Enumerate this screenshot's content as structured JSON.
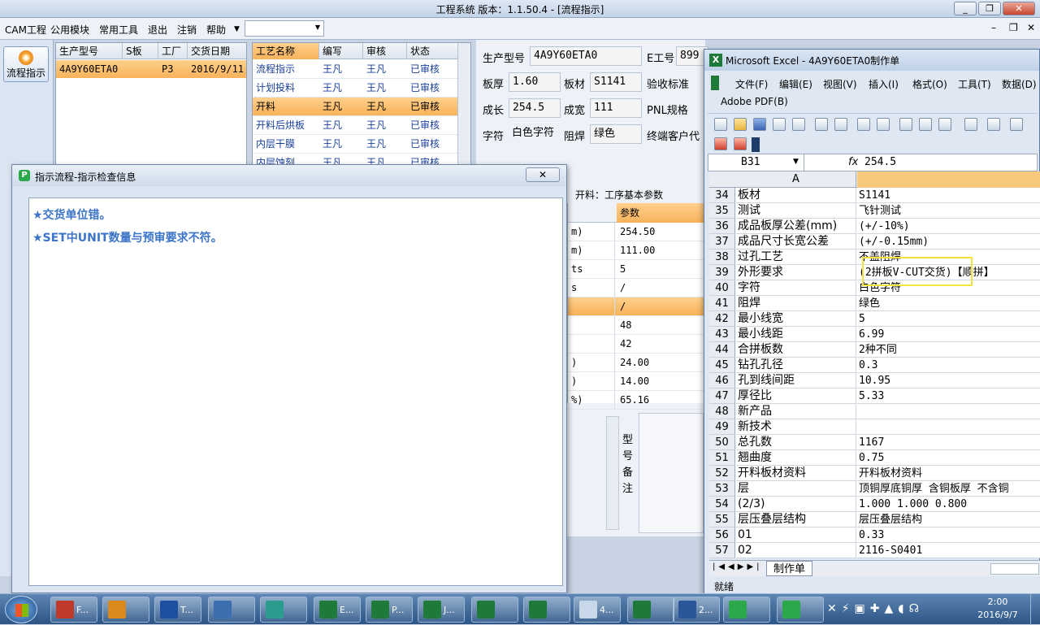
{
  "app": {
    "title": "工程系统  版本：1.1.50.4 - [流程指示]",
    "menu": [
      "CAM工程",
      "公用模块",
      "常用工具",
      "退出",
      "注销",
      "帮助"
    ]
  },
  "left_panel": {
    "flow_button": "流程指示"
  },
  "order_table": {
    "headers": [
      "生产型号",
      "S板",
      "工厂",
      "交货日期"
    ],
    "rows": [
      [
        "4A9Y60ETA0",
        "",
        "P3",
        "2016/9/11"
      ]
    ]
  },
  "process_table": {
    "headers": [
      "工艺名称",
      "编写",
      "审核",
      "状态"
    ],
    "rows": [
      [
        "流程指示",
        "王凡",
        "王凡",
        "已审核"
      ],
      [
        "计划投料",
        "王凡",
        "王凡",
        "已审核"
      ],
      [
        "开料",
        "王凡",
        "王凡",
        "已审核"
      ],
      [
        "开料后烘板",
        "王凡",
        "王凡",
        "已审核"
      ],
      [
        "内层干膜",
        "王凡",
        "王凡",
        "已审核"
      ],
      [
        "内层蚀刻",
        "王凡",
        "王凡",
        "已审核"
      ]
    ],
    "selected_index": 2
  },
  "form": {
    "product_label": "生产型号",
    "product_value": "4A9Y60ETA0",
    "e_label": "E工号",
    "e_value": "899",
    "thickness_label": "板厚",
    "thickness_value": "1.60",
    "material_label": "板材",
    "material_value": "S1141",
    "standard_label": "验收标准",
    "length_label": "成长",
    "length_value": "254.5",
    "width_label": "成宽",
    "width_value": "111",
    "pnl_label": "PNL规格",
    "char_label": "字符",
    "char_value": "白色字符",
    "mask_label": "阻焊",
    "mask_value": "绿色",
    "customer_label": "终端客户代"
  },
  "param_panel": {
    "title": "开料：工序基本参数",
    "param_header": "参数",
    "rows": [
      {
        "name": "m)",
        "value": "254.50"
      },
      {
        "name": "m)",
        "value": "111.00"
      },
      {
        "name": "ts",
        "value": "5"
      },
      {
        "name": "s",
        "value": "/"
      },
      {
        "name": "",
        "value": "/"
      },
      {
        "name": "",
        "value": "48"
      },
      {
        "name": "",
        "value": "42"
      },
      {
        "name": ")",
        "value": "24.00"
      },
      {
        "name": ")",
        "value": "14.00"
      },
      {
        "name": "%)",
        "value": "65.16"
      }
    ],
    "memo_label": "型号备注"
  },
  "dialog": {
    "title": "指示流程-指示检查信息",
    "messages": [
      "★交货单位错。",
      "★SET中UNIT数量与预审要求不符。"
    ]
  },
  "excel": {
    "title": "Microsoft Excel - 4A9Y60ETA0制作单",
    "menu": [
      "文件(F)",
      "编辑(E)",
      "视图(V)",
      "插入(I)",
      "格式(O)",
      "工具(T)",
      "数据(D)"
    ],
    "adobe": "Adobe PDF(B)",
    "name_box": "B31",
    "fx": "fx",
    "formula": "254.5",
    "col_a": "A",
    "rows": [
      {
        "n": "34",
        "a": "板材",
        "b": "S1141"
      },
      {
        "n": "35",
        "a": "测试",
        "b": "飞针测试"
      },
      {
        "n": "36",
        "a": "成品板厚公差(mm)",
        "b": "(+/-10%)"
      },
      {
        "n": "37",
        "a": "成品尺寸长宽公差",
        "b": "(+/-0.15mm)"
      },
      {
        "n": "38",
        "a": "过孔工艺",
        "b": "不盖阻焊"
      },
      {
        "n": "39",
        "a": "外形要求",
        "b": "(2拼板V-CUT交货)【顺拼】"
      },
      {
        "n": "40",
        "a": "字符",
        "b": "白色字符"
      },
      {
        "n": "41",
        "a": "阻焊",
        "b": "绿色"
      },
      {
        "n": "42",
        "a": "最小线宽",
        "b": "5"
      },
      {
        "n": "43",
        "a": "最小线距",
        "b": "6.99"
      },
      {
        "n": "44",
        "a": "合拼板数",
        "b": "2种不同"
      },
      {
        "n": "45",
        "a": "钻孔孔径",
        "b": "0.3"
      },
      {
        "n": "46",
        "a": "孔到线间距",
        "b": "10.95"
      },
      {
        "n": "47",
        "a": "厚径比",
        "b": "5.33"
      },
      {
        "n": "48",
        "a": "新产品",
        "b": ""
      },
      {
        "n": "49",
        "a": "新技术",
        "b": ""
      },
      {
        "n": "50",
        "a": "总孔数",
        "b": "1167"
      },
      {
        "n": "51",
        "a": "翘曲度",
        "b": "0.75"
      },
      {
        "n": "52",
        "a": "开料板材资料",
        "b": "开料板材资料"
      },
      {
        "n": "53",
        "a": "层",
        "b": "顶铜厚底铜厚 含铜板厚 不含铜"
      },
      {
        "n": "54",
        "a": "(2/3)",
        "b": "1.000  1.000          0.800"
      },
      {
        "n": "55",
        "a": "层压叠层结构",
        "b": "层压叠层结构"
      },
      {
        "n": "56",
        "a": "01",
        "b": "0.33"
      },
      {
        "n": "57",
        "a": "02",
        "b": "2116-S0401"
      }
    ],
    "sheet_tab": "制作单",
    "status": "就绪"
  },
  "taskbar": {
    "buttons": [
      "F...",
      "",
      "T...",
      "",
      "",
      "E...",
      "P...",
      "J...",
      "",
      "",
      "4...",
      "",
      "2...",
      "",
      ""
    ],
    "time": "2:00",
    "date": "2016/9/7"
  }
}
